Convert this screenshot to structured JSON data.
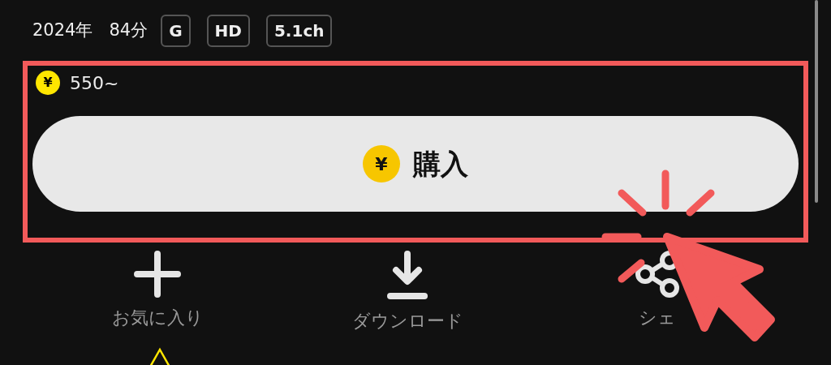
{
  "meta": {
    "year": "2024年",
    "duration": "84分",
    "badges": [
      "G",
      "HD",
      "5.1ch"
    ]
  },
  "price": {
    "currency_symbol": "¥",
    "text": "550~"
  },
  "purchase_button": {
    "currency_symbol": "¥",
    "label": "購入"
  },
  "actions": [
    {
      "kind": "favorite",
      "label": "お気に入り"
    },
    {
      "kind": "download",
      "label": "ダウンロード"
    },
    {
      "kind": "share",
      "label": "シェ"
    }
  ]
}
